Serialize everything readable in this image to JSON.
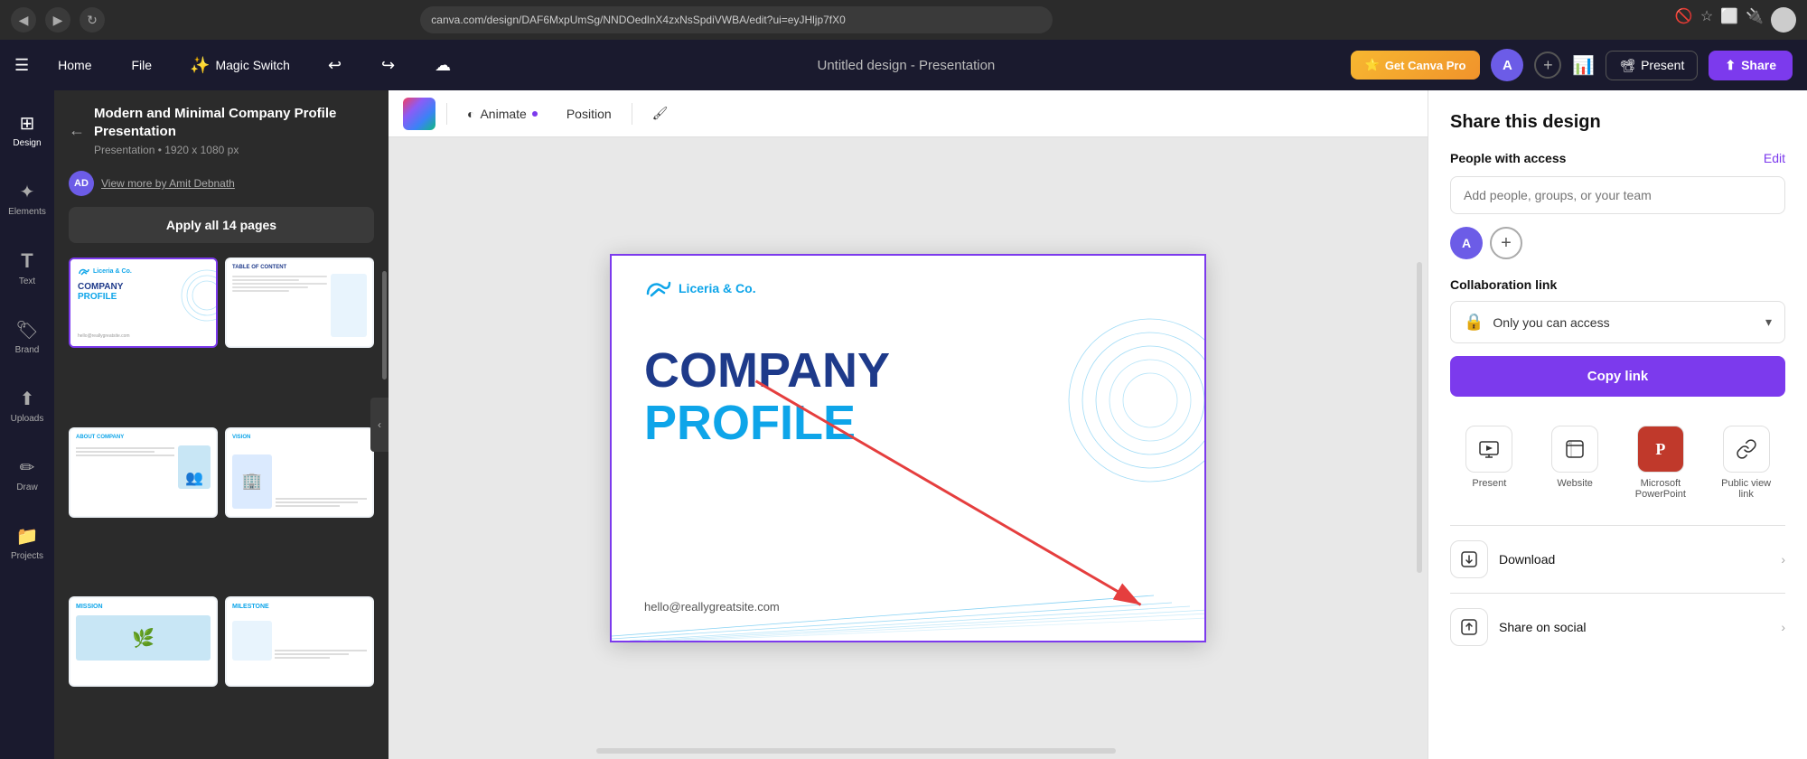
{
  "browser": {
    "url": "canva.com/design/DAF6MxpUmSg/NNDOedlnX4zxNsSpdiVWBA/edit?ui=eyJHljp7fX0",
    "back_icon": "◀",
    "forward_icon": "▶",
    "refresh_icon": "↻"
  },
  "app_header": {
    "home_label": "Home",
    "file_label": "File",
    "magic_switch_label": "Magic Switch",
    "magic_switch_emoji": "✨",
    "undo_icon": "↩",
    "redo_icon": "↪",
    "save_icon": "☁",
    "design_title": "Untitled design - Presentation",
    "get_pro_label": "Get Canva Pro",
    "get_pro_emoji": "⭐",
    "present_label": "Present",
    "share_label": "Share",
    "avatar_initial": "A"
  },
  "sidebar": {
    "items": [
      {
        "id": "design",
        "icon": "⊞",
        "label": "Design"
      },
      {
        "id": "elements",
        "icon": "✦",
        "label": "Elements"
      },
      {
        "id": "text",
        "icon": "T",
        "label": "Text"
      },
      {
        "id": "brand",
        "icon": "🏷",
        "label": "Brand"
      },
      {
        "id": "uploads",
        "icon": "↑",
        "label": "Uploads"
      },
      {
        "id": "draw",
        "icon": "✏",
        "label": "Draw"
      },
      {
        "id": "projects",
        "icon": "📁",
        "label": "Projects"
      }
    ]
  },
  "template_panel": {
    "title": "Modern and Minimal Company Profile Presentation",
    "subtitle": "Presentation • 1920 x 1080 px",
    "author_initials": "AD",
    "author_link": "View more by Amit Debnath",
    "apply_label": "Apply all 14 pages",
    "back_icon": "←",
    "templates": [
      {
        "id": 1,
        "label": "COMPANY PROFILE",
        "type": "cover"
      },
      {
        "id": 2,
        "label": "TABLE OF CONTENT",
        "type": "toc"
      },
      {
        "id": 3,
        "label": "ABOUT COMPANY",
        "type": "about"
      },
      {
        "id": 4,
        "label": "VISION",
        "type": "vision"
      },
      {
        "id": 5,
        "label": "MISSION",
        "type": "mission"
      },
      {
        "id": 6,
        "label": "MILESTONE",
        "type": "milestone"
      }
    ]
  },
  "toolbar": {
    "animate_label": "Animate",
    "position_label": "Position",
    "format_icon": "🖌"
  },
  "canvas": {
    "slide": {
      "logo_text": "Liceria & Co.",
      "title_line1": "COMPANY",
      "title_line2": "PROFILE",
      "email": "hello@reallygreatsite.com"
    }
  },
  "share_panel": {
    "title": "Share this design",
    "people_label": "People with access",
    "edit_label": "Edit",
    "people_placeholder": "Add people, groups, or your team",
    "avatar_initial": "A",
    "collab_label": "Collaboration link",
    "access_text": "Only you can access",
    "copy_link_label": "Copy link",
    "share_options": [
      {
        "id": "present",
        "icon": "📺",
        "label": "Present"
      },
      {
        "id": "website",
        "icon": "🌐",
        "label": "Website"
      },
      {
        "id": "powerpoint",
        "icon": "P",
        "label": "Microsoft PowerPoint",
        "is_powerpoint": true
      },
      {
        "id": "public-link",
        "icon": "🔗",
        "label": "Public view link"
      }
    ],
    "list_items": [
      {
        "id": "download",
        "icon": "⬇",
        "label": "Download"
      },
      {
        "id": "share-social",
        "icon": "↗",
        "label": "Share on social"
      }
    ]
  },
  "colors": {
    "accent_purple": "#7c3aed",
    "accent_blue": "#0ea5e9",
    "dark_navy": "#1e3a8a",
    "canva_dark": "#1a1a2e",
    "pro_gold": "#f7b731"
  }
}
